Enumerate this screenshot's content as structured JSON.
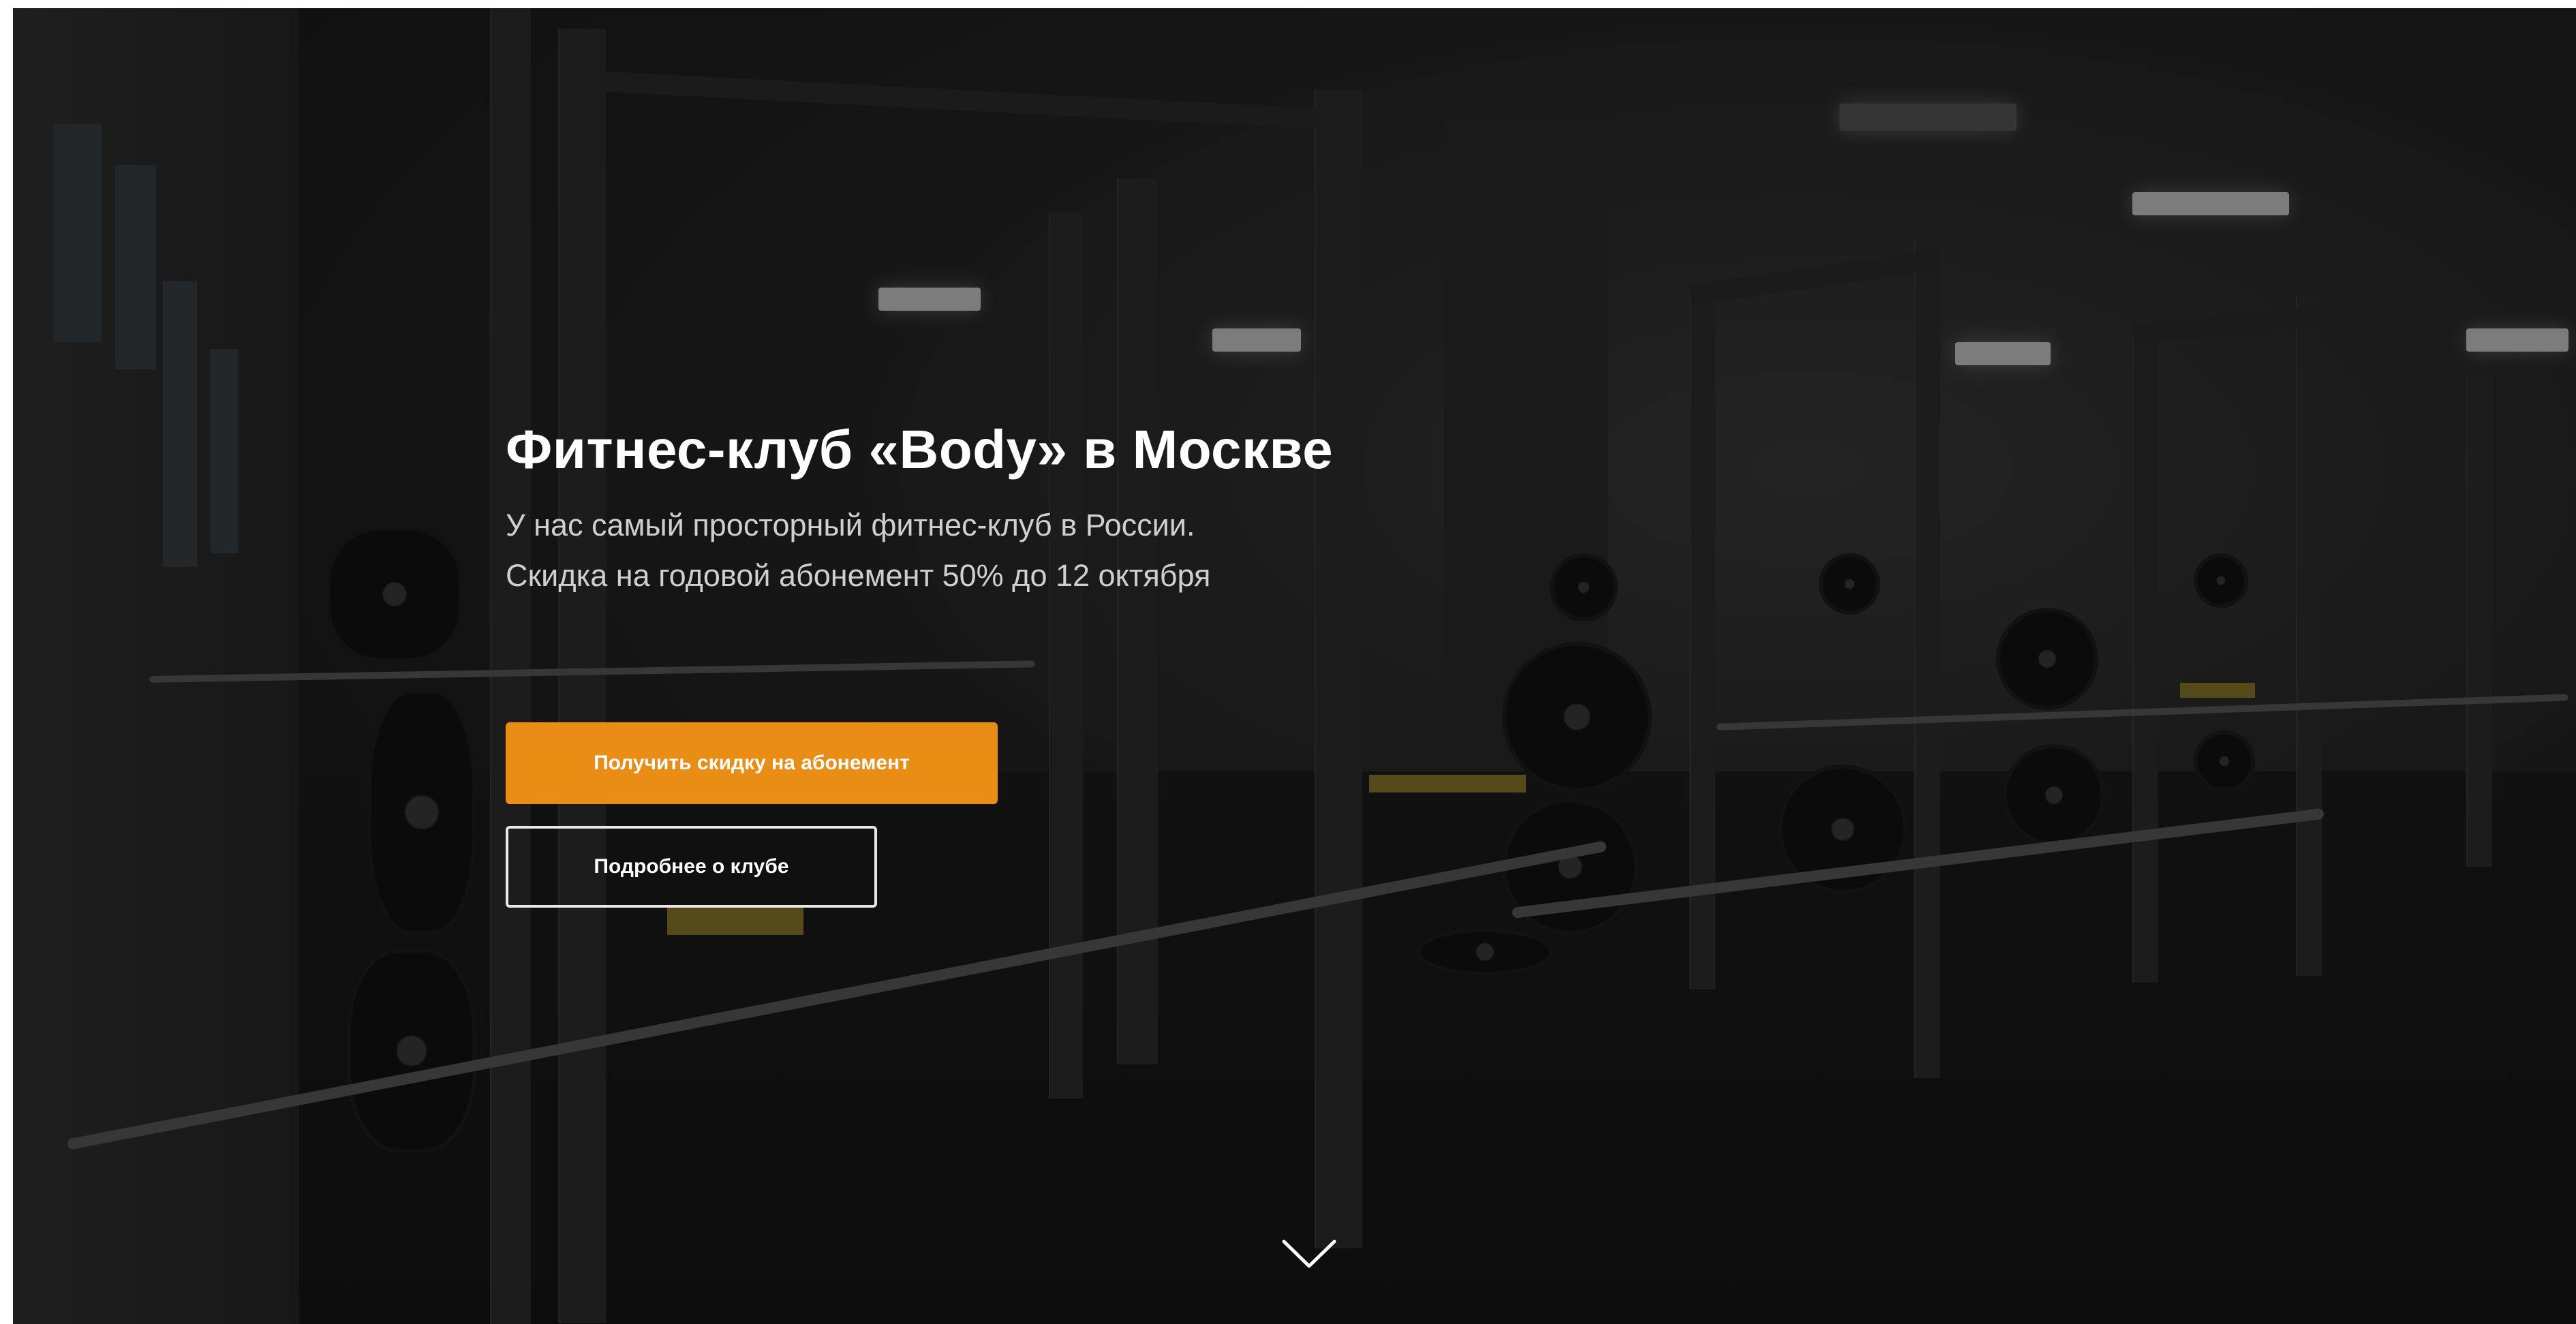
{
  "hero": {
    "title": "Фитнес-клуб «Body» в Москве",
    "subtitle_line1": "У нас самый просторный фитнес-клуб в России.",
    "subtitle_line2": "Скидка на годовой абонемент 50% до 12 октября",
    "primary_button": "Получить скидку на абонемент",
    "secondary_button": "Подробнее о клубе",
    "scroll_icon": "chevron-down-icon",
    "background_image": "gym-interior",
    "accent_color": "#ea8d14"
  }
}
